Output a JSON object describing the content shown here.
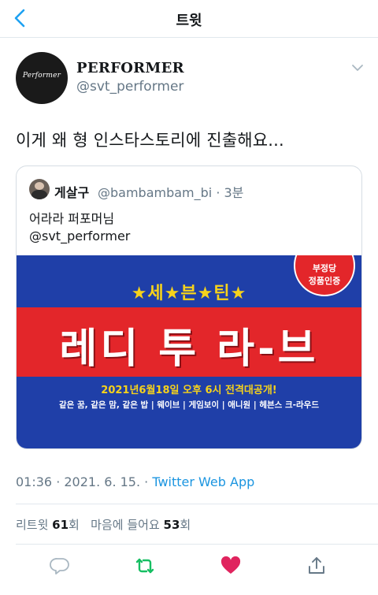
{
  "nav": {
    "title": "트윗"
  },
  "author": {
    "display_name": "PERFORMER",
    "handle": "@svt_performer",
    "avatar_text": "Performer"
  },
  "tweet": {
    "text": "이게 왜 형 인스타스토리에 진출해요..."
  },
  "quoted_tweet": {
    "name": "게살구",
    "handle_time": "@bambambam_bi · 3분",
    "line1": "어라라 퍼포머님",
    "line2": "@svt_performer",
    "poster": {
      "stars_title": "★세★븐★틴★",
      "main_title": "레디 투 라-브",
      "date_line": "2021년6월18일 오후 6시 전격대공개!",
      "info_line": "같은 꿈, 같은 맘, 같은 밥 | 웨이브 | 게임보이 | 애니원 | 헤븐스 크-라우드",
      "stamp_top": "부정당",
      "stamp_bottom": "정품인증"
    }
  },
  "meta": {
    "time_date": "01:36 · 2021. 6. 15. · ",
    "source": "Twitter Web App"
  },
  "stats": {
    "retweet_label": "리트윗 ",
    "retweet_count": "61",
    "retweet_unit": "회",
    "like_label": "마음에 들어요 ",
    "like_count": "53",
    "like_unit": "회"
  },
  "actions": [
    {
      "name": "reply",
      "icon": "speech-bubble-icon"
    },
    {
      "name": "retweet",
      "icon": "retweet-icon"
    },
    {
      "name": "like",
      "icon": "heart-icon"
    },
    {
      "name": "share",
      "icon": "share-icon"
    }
  ],
  "colors": {
    "link_blue": "#1b95e0",
    "retweet_green": "#17bf63",
    "like_red": "#e0245e",
    "poster_blue": "#1f3fa8",
    "poster_red": "#e3262a",
    "poster_yellow": "#f6d21b"
  }
}
